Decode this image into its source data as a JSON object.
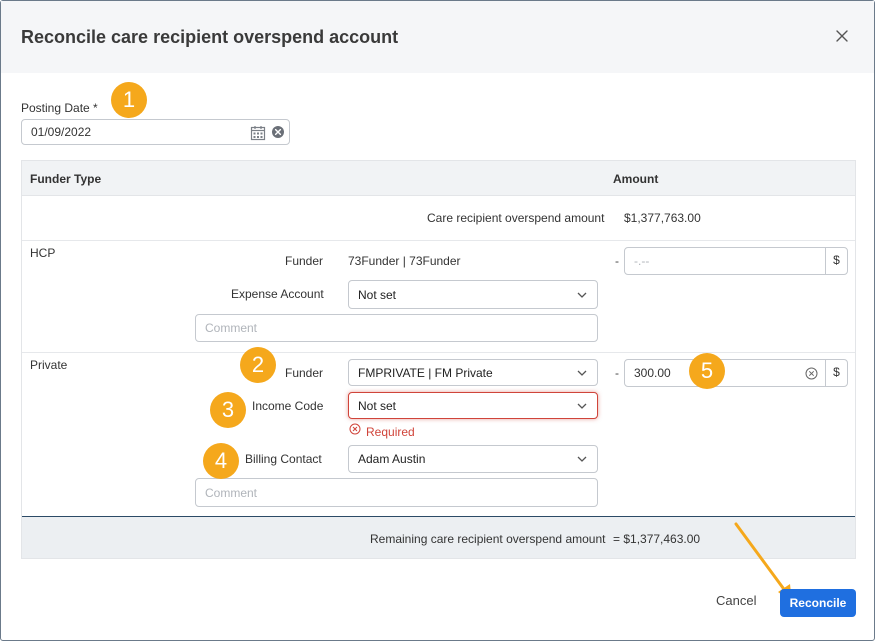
{
  "dialog": {
    "title": "Reconcile care recipient overspend account",
    "close_icon": "close-icon"
  },
  "posting_date": {
    "label": "Posting Date *",
    "value": "01/09/2022",
    "calendar_icon": "calendar-icon",
    "clear_icon": "clear-circle-icon"
  },
  "table": {
    "col_funder_type": "Funder Type",
    "col_amount": "Amount",
    "overspend_label": "Care recipient overspend amount",
    "overspend_value": "$1,377,763.00",
    "hcp": {
      "type": "HCP",
      "funder_label": "Funder",
      "funder_value": "73Funder | 73Funder",
      "expense_label": "Expense Account",
      "expense_value": "Not set",
      "comment_placeholder": "Comment",
      "dash": "-",
      "amount_placeholder": "-.--",
      "currency": "$"
    },
    "private": {
      "type": "Private",
      "funder_label": "Funder",
      "funder_value": "FMPRIVATE | FM Private",
      "income_label": "Income Code",
      "income_value": "Not set",
      "required_text": "Required",
      "billing_label": "Billing Contact",
      "billing_value": "Adam Austin",
      "comment_placeholder": "Comment",
      "dash": "-",
      "amount_value": "300.00",
      "currency": "$"
    },
    "remaining_label": "Remaining care recipient overspend amount",
    "remaining_value": "= $1,377,463.00"
  },
  "badges": [
    "1",
    "2",
    "3",
    "4",
    "5"
  ],
  "actions": {
    "cancel_label": "Cancel",
    "reconcile_label": "Reconcile"
  },
  "colors": {
    "primary": "#1f6fe0",
    "badge": "#f5a81c",
    "error": "#d0443a"
  }
}
